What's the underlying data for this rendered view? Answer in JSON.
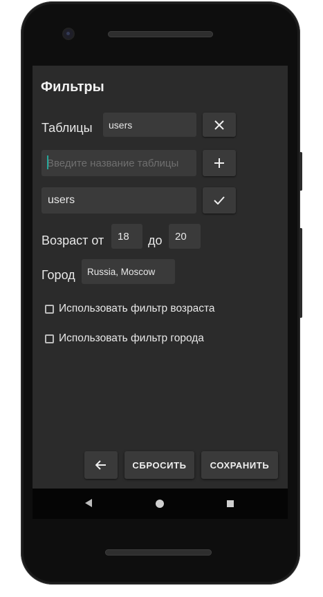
{
  "screen": {
    "title": "Фильтры",
    "tables_label": "Таблицы",
    "selected_table_chip": "users",
    "table_input_placeholder": "Введите название таблицы",
    "suggested_table": "users",
    "age_label": "Возраст от",
    "age_from": "18",
    "age_to_label": "до",
    "age_to": "20",
    "city_label": "Город",
    "city_value": "Russia, Moscow",
    "use_age_filter_label": "Использовать фильтр возраста",
    "use_city_filter_label": "Использовать фильтр города",
    "use_age_filter_checked": false,
    "use_city_filter_checked": false
  },
  "actions": {
    "reset_label": "СБРОСИТЬ",
    "save_label": "СОХРАНИТЬ"
  },
  "icons": {
    "remove": "close-icon",
    "add": "plus-icon",
    "confirm": "check-icon",
    "back": "arrow-left-icon"
  },
  "colors": {
    "background": "#2b2b2b",
    "surface": "#3a3a3a",
    "text": "#e8e8e8",
    "cursor": "#26a69a"
  }
}
